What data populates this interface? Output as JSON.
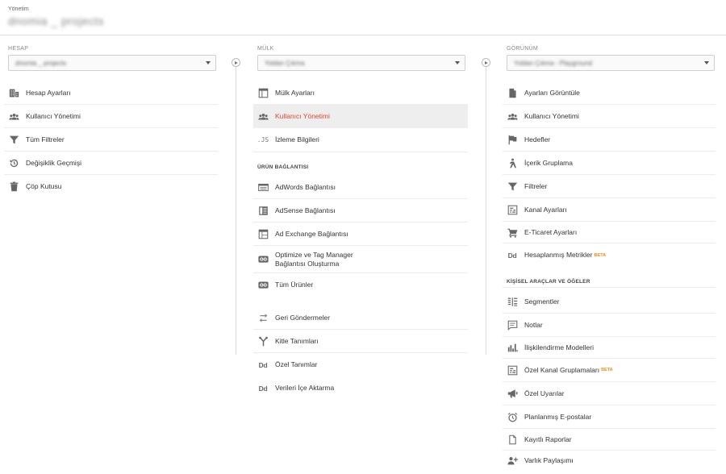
{
  "header": {
    "admin_label": "Yönetim",
    "account_name": "dnomia _ projects"
  },
  "columns": {
    "account": {
      "label": "HESAP",
      "selected": "dnomia _ projects",
      "items": [
        {
          "label": "Hesap Ayarları",
          "icon": "building-icon"
        },
        {
          "label": "Kullanıcı Yönetimi",
          "icon": "users-icon"
        },
        {
          "label": "Tüm Filtreler",
          "icon": "filter-icon"
        },
        {
          "label": "Değişiklik Geçmişi",
          "icon": "history-icon"
        },
        {
          "label": "Çöp Kutusu",
          "icon": "trash-icon"
        }
      ]
    },
    "property": {
      "label": "MÜLK",
      "selected": "Yoldan Çıkma",
      "items": [
        {
          "label": "Mülk Ayarları",
          "icon": "settings-window-icon"
        },
        {
          "label": "Kullanıcı Yönetimi",
          "icon": "users-icon",
          "active": true
        },
        {
          "label": "İzleme Bilgileri",
          "icon": "js-icon"
        }
      ],
      "product_section": "ÜRÜN BAĞLANTISI",
      "product_items": [
        {
          "label": "AdWords Bağlantısı",
          "icon": "adwords-icon"
        },
        {
          "label": "AdSense Bağlantısı",
          "icon": "adsense-icon"
        },
        {
          "label": "Ad Exchange Bağlantısı",
          "icon": "ad-exchange-icon"
        },
        {
          "label_line1": "Optimize ve Tag Manager",
          "label_line2": "Bağlantısı Oluşturma",
          "icon": "link-icon"
        },
        {
          "label": "Tüm Ürünler",
          "icon": "link-icon"
        }
      ],
      "more_items": [
        {
          "label": "Geri Göndermeler",
          "icon": "postback-icon"
        },
        {
          "label": "Kitle Tanımları",
          "icon": "audience-icon"
        },
        {
          "label": "Özel Tanımlar",
          "icon": "dd-icon",
          "glyph": "Dd"
        },
        {
          "label": "Verileri İçe Aktarma",
          "icon": "dd-icon",
          "glyph": "Dd"
        }
      ]
    },
    "view": {
      "label": "GÖRÜNÜM",
      "selected": "Yoldan Çıkma - Playground",
      "items": [
        {
          "label": "Ayarları Görüntüle",
          "icon": "document-icon"
        },
        {
          "label": "Kullanıcı Yönetimi",
          "icon": "users-icon"
        },
        {
          "label": "Hedefler",
          "icon": "flag-icon"
        },
        {
          "label": "İçerik Gruplama",
          "icon": "person-icon"
        },
        {
          "label": "Filtreler",
          "icon": "filter-icon"
        },
        {
          "label": "Kanal Ayarları",
          "icon": "channel-icon"
        },
        {
          "label": "E-Ticaret Ayarları",
          "icon": "cart-icon"
        },
        {
          "label": "Hesaplanmış Metrikler",
          "icon": "dd-icon",
          "glyph": "Dd",
          "badge": "BETA"
        }
      ],
      "personal_section": "KİŞİSEL ARAÇLAR VE ÖĞELER",
      "personal_items": [
        {
          "label": "Segmentler",
          "icon": "segments-icon"
        },
        {
          "label": "Notlar",
          "icon": "notes-icon"
        },
        {
          "label": "İlişkilendirme Modelleri",
          "icon": "bar-chart-icon"
        },
        {
          "label": "Özel Kanal Gruplamaları",
          "icon": "channel-icon",
          "badge": "BETA"
        },
        {
          "label": "Özel Uyarılar",
          "icon": "megaphone-icon"
        },
        {
          "label": "Planlanmış E-postalar",
          "icon": "alarm-icon"
        },
        {
          "label": "Kayıtlı Raporlar",
          "icon": "report-icon"
        },
        {
          "label": "Varlık Paylaşımı",
          "icon": "share-user-icon"
        }
      ]
    }
  }
}
